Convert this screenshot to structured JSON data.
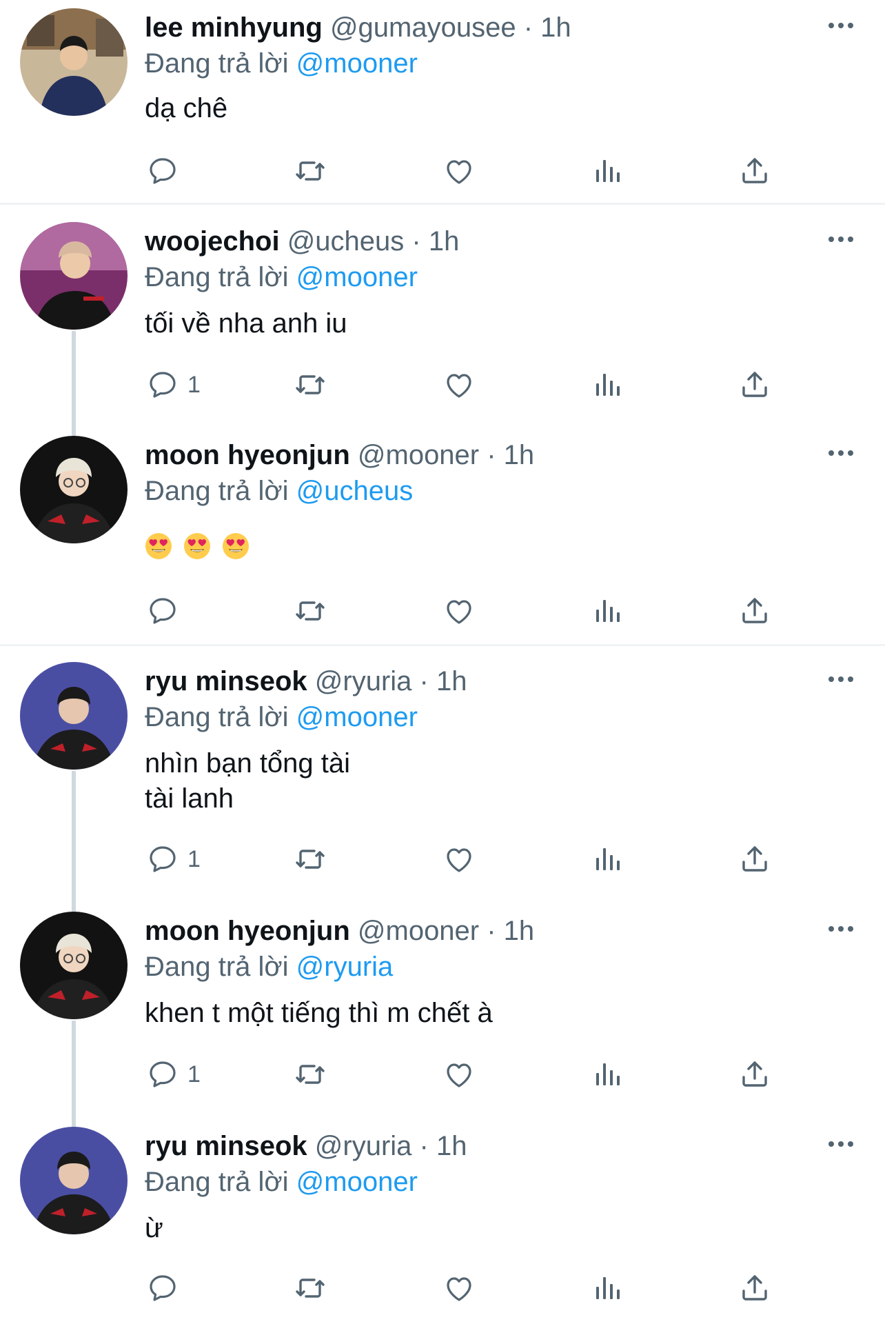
{
  "reply_prefix": "Đang trả lời",
  "colors": {
    "accent": "#1d9bf0",
    "secondary_text": "#536471",
    "thread_line": "#cfd9de"
  },
  "tweets": [
    {
      "name": "lee minhyung",
      "handle": "@gumayousee",
      "time": "· 1h",
      "reply_to": "@mooner",
      "text": "dạ chê",
      "reply_count": ""
    },
    {
      "name": "woojechoi",
      "handle": "@ucheus",
      "time": "· 1h",
      "reply_to": "@mooner",
      "text": "tối về nha anh iu",
      "reply_count": "1"
    },
    {
      "name": "moon hyeonjun",
      "handle": "@mooner",
      "time": "· 1h",
      "reply_to": "@ucheus",
      "text": "",
      "emojis": [
        "😍",
        "😍",
        "😍"
      ],
      "reply_count": ""
    },
    {
      "name": "ryu minseok",
      "handle": "@ryuria",
      "time": "· 1h",
      "reply_to": "@mooner",
      "text": "nhìn bạn tổng tài\ntài lanh",
      "reply_count": "1"
    },
    {
      "name": "moon hyeonjun",
      "handle": "@mooner",
      "time": "· 1h",
      "reply_to": "@ryuria",
      "text": "khen t một tiếng thì m chết à",
      "reply_count": "1"
    },
    {
      "name": "ryu minseok",
      "handle": "@ryuria",
      "time": "· 1h",
      "reply_to": "@mooner",
      "text": "ừ",
      "reply_count": ""
    }
  ],
  "icons": [
    "reply-icon",
    "retweet-icon",
    "like-icon",
    "views-icon",
    "share-icon",
    "more-icon"
  ]
}
